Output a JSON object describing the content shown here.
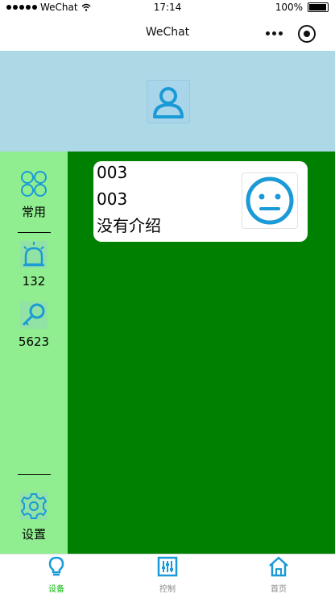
{
  "status_bar": {
    "carrier": "WeChat",
    "time": "17:14",
    "battery": "100%"
  },
  "nav": {
    "title": "WeChat"
  },
  "sidebar": {
    "items": [
      {
        "label": "常用",
        "icon": "grid-icon"
      },
      {
        "label": "132",
        "icon": "alarm-light-icon"
      },
      {
        "label": "5623",
        "icon": "search-key-icon"
      }
    ],
    "settings": {
      "label": "设置",
      "icon": "gear-icon"
    }
  },
  "card": {
    "line1": "003",
    "line2": "003",
    "line3": "没有介绍"
  },
  "tabs": [
    {
      "label": "设备",
      "icon": "bulb-icon",
      "active": true
    },
    {
      "label": "控制",
      "icon": "sliders-icon",
      "active": false
    },
    {
      "label": "首页",
      "icon": "home-icon",
      "active": false
    }
  ],
  "colors": {
    "accent": "#1a9ad6",
    "active_tab": "#09bb07",
    "header_bg": "#add8e6",
    "sidebar_bg": "#90ee90",
    "main_bg": "#008000"
  }
}
